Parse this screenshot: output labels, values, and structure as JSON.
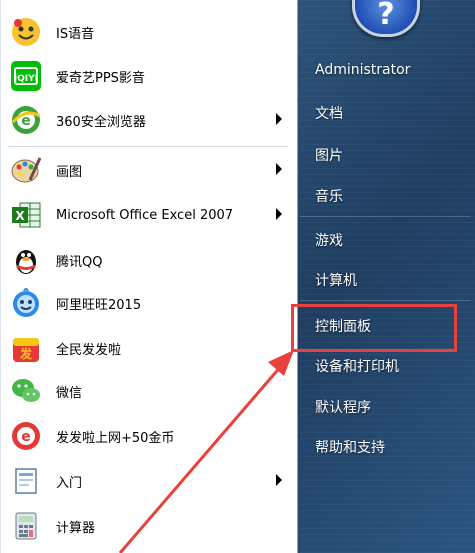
{
  "left_menu": {
    "items": [
      {
        "label": "IS语音",
        "icon": "is-voice-icon",
        "submenu": false
      },
      {
        "label": "爱奇艺PPS影音",
        "icon": "iqiyi-icon",
        "submenu": false
      },
      {
        "label": "360安全浏览器",
        "icon": "360-browser-icon",
        "submenu": true
      },
      {
        "label": "画图",
        "icon": "paint-palette-icon",
        "submenu": true
      },
      {
        "label": "Microsoft Office Excel 2007",
        "icon": "excel-icon",
        "submenu": true
      },
      {
        "label": "腾讯QQ",
        "icon": "qq-penguin-icon",
        "submenu": false
      },
      {
        "label": "阿里旺旺2015",
        "icon": "aliwangwang-icon",
        "submenu": false
      },
      {
        "label": "全民发发啦",
        "icon": "fafala-icon",
        "submenu": false
      },
      {
        "label": "微信",
        "icon": "wechat-icon",
        "submenu": false
      },
      {
        "label": "发发啦上网+50金币",
        "icon": "fafala-browser-icon",
        "submenu": false
      },
      {
        "label": "入门",
        "icon": "getting-started-icon",
        "submenu": true
      },
      {
        "label": "计算器",
        "icon": "calculator-icon",
        "submenu": false
      }
    ]
  },
  "right_menu": {
    "items": [
      {
        "label": "Administrator"
      },
      {
        "label": "文档"
      },
      {
        "label": "图片"
      },
      {
        "label": "音乐"
      },
      {
        "label": "游戏"
      },
      {
        "label": "计算机"
      },
      {
        "label": "控制面板"
      },
      {
        "label": "设备和打印机"
      },
      {
        "label": "默认程序"
      },
      {
        "label": "帮助和支持"
      }
    ]
  },
  "user_picture_glyph": "?",
  "colors": {
    "highlight": "#e8403a",
    "arrow": "#e8403a"
  }
}
